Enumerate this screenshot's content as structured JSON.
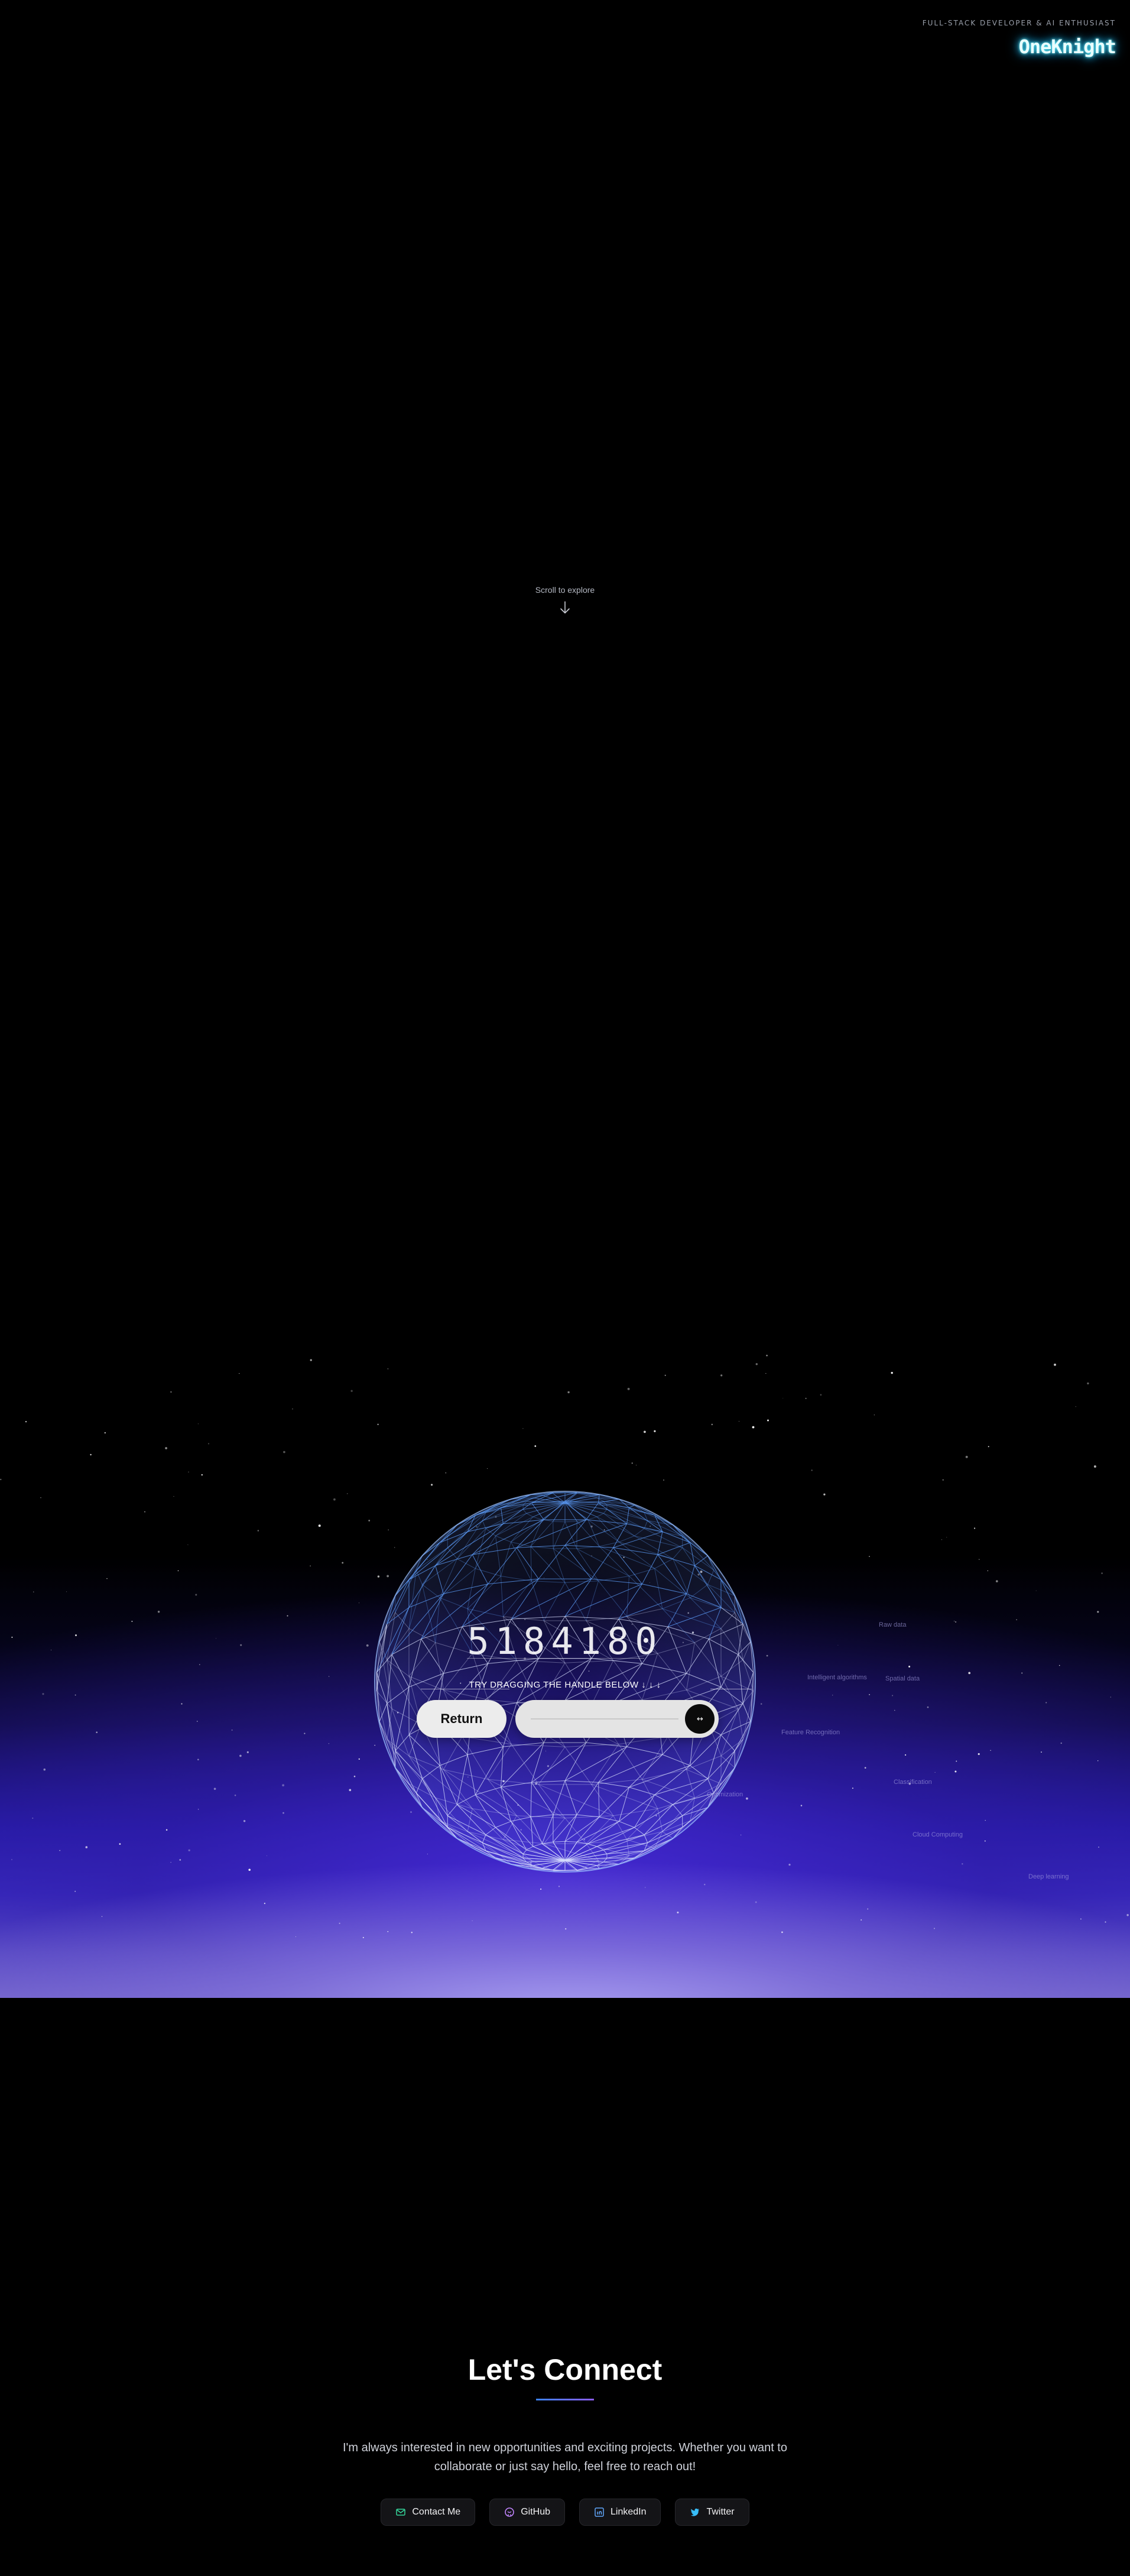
{
  "header": {
    "tagline": "FULL-STACK DEVELOPER & AI ENTHUSIAST",
    "logo": "OneKnight"
  },
  "hero": {
    "scroll_label": "Scroll to explore",
    "scroll_icon": "arrow-down-icon"
  },
  "galaxy": {
    "counter": "5184180",
    "drag_hint": "TRY DRAGGING THE HANDLE BELOW ↓ ↓ ↓",
    "return_label": "Return",
    "handle_icon": "arrows-left-right-icon",
    "handle_glyph": "↔",
    "floating_labels": [
      "Raw data",
      "Intelligent algorithms",
      "Spatial data",
      "Feature Recognition",
      "Classification",
      "Cloud Computing",
      "Optimization",
      "Deep learning"
    ],
    "colors": {
      "sky": "#3b2ec4",
      "horizon": "#8a7dd6",
      "sphere": "#8fb6ff"
    }
  },
  "connect": {
    "title": "Let's Connect",
    "text": "I'm always interested in new opportunities and exciting projects. Whether you want to collaborate or just say hello, feel free to reach out!",
    "buttons": [
      {
        "label": "Contact Me",
        "icon": "mail-icon",
        "color": "#34d399"
      },
      {
        "label": "GitHub",
        "icon": "github-icon",
        "color": "#c084fc"
      },
      {
        "label": "LinkedIn",
        "icon": "linkedin-icon",
        "color": "#60a5fa"
      },
      {
        "label": "Twitter",
        "icon": "twitter-icon",
        "color": "#38bdf8"
      }
    ]
  }
}
